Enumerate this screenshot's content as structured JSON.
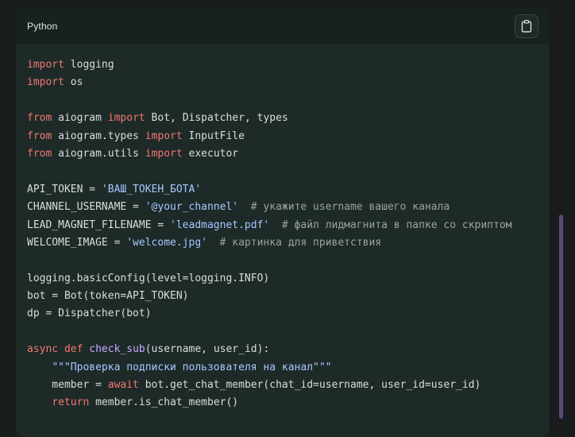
{
  "code_block": {
    "language": "Python",
    "copy_icon": "clipboard-icon",
    "lines": [
      [
        [
          "kw",
          "import"
        ],
        [
          "plain",
          " logging"
        ]
      ],
      [
        [
          "kw",
          "import"
        ],
        [
          "plain",
          " os"
        ]
      ],
      [],
      [
        [
          "kw",
          "from"
        ],
        [
          "plain",
          " aiogram "
        ],
        [
          "kw",
          "import"
        ],
        [
          "plain",
          " Bot, Dispatcher, types"
        ]
      ],
      [
        [
          "kw",
          "from"
        ],
        [
          "plain",
          " aiogram.types "
        ],
        [
          "kw",
          "import"
        ],
        [
          "plain",
          " InputFile"
        ]
      ],
      [
        [
          "kw",
          "from"
        ],
        [
          "plain",
          " aiogram.utils "
        ],
        [
          "kw",
          "import"
        ],
        [
          "plain",
          " executor"
        ]
      ],
      [],
      [
        [
          "plain",
          "API_TOKEN = "
        ],
        [
          "st",
          "'ВАШ_ТОКЕН_БОТА'"
        ]
      ],
      [
        [
          "plain",
          "CHANNEL_USERNAME = "
        ],
        [
          "st",
          "'@your_channel'"
        ],
        [
          "cm",
          "  # укажите username вашего канала"
        ]
      ],
      [
        [
          "plain",
          "LEAD_MAGNET_FILENAME = "
        ],
        [
          "st",
          "'leadmagnet.pdf'"
        ],
        [
          "cm",
          "  # файл лидмагнита в папке со скриптом"
        ]
      ],
      [
        [
          "plain",
          "WELCOME_IMAGE = "
        ],
        [
          "st",
          "'welcome.jpg'"
        ],
        [
          "cm",
          "  # картинка для приветствия"
        ]
      ],
      [],
      [
        [
          "plain",
          "logging.basicConfig(level=logging.INFO)"
        ]
      ],
      [
        [
          "plain",
          "bot = Bot(token=API_TOKEN)"
        ]
      ],
      [
        [
          "plain",
          "dp = Dispatcher(bot)"
        ]
      ],
      [],
      [
        [
          "kw",
          "async"
        ],
        [
          "plain",
          " "
        ],
        [
          "kw",
          "def"
        ],
        [
          "plain",
          " "
        ],
        [
          "fn",
          "check_sub"
        ],
        [
          "plain",
          "(username, user_id):"
        ]
      ],
      [
        [
          "plain",
          "    "
        ],
        [
          "st",
          "\"\"\"Проверка подписки пользователя на канал\"\"\""
        ]
      ],
      [
        [
          "plain",
          "    member = "
        ],
        [
          "kw",
          "await"
        ],
        [
          "plain",
          " bot.get_chat_member(chat_id=username, user_id=user_id)"
        ]
      ],
      [
        [
          "plain",
          "    "
        ],
        [
          "kw",
          "return"
        ],
        [
          "plain",
          " member.is_chat_member()"
        ]
      ]
    ]
  }
}
